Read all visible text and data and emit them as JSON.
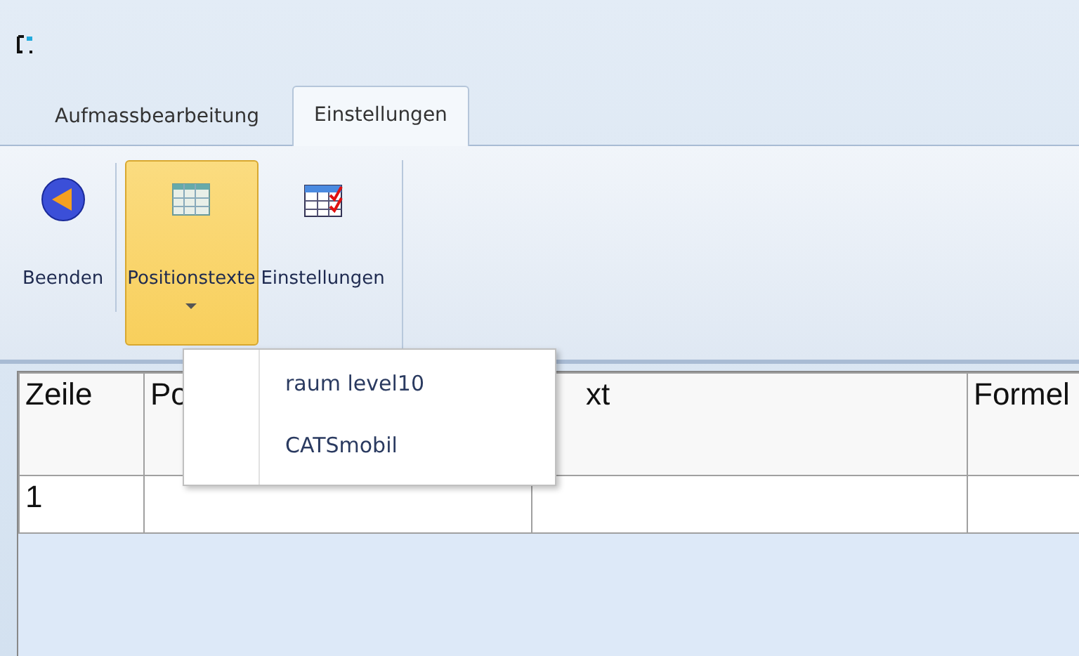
{
  "tabs": [
    {
      "label": "Aufmassbearbeitung",
      "selected": false
    },
    {
      "label": "Einstellungen",
      "selected": true
    }
  ],
  "ribbon": [
    {
      "label": "Beenden",
      "kind": "back",
      "highlighted": false,
      "dropdown": false
    },
    {
      "label": "Positionstexte",
      "kind": "table",
      "highlighted": true,
      "dropdown": true
    },
    {
      "label": "Einstellungen",
      "kind": "checklist",
      "highlighted": false,
      "dropdown": false
    }
  ],
  "menu": {
    "items": [
      "raum level10",
      "CATSmobil"
    ]
  },
  "table": {
    "columns": [
      "Zeile",
      "Po",
      "xt",
      "Formel"
    ],
    "rows": [
      [
        "1",
        "",
        "",
        ""
      ]
    ]
  }
}
